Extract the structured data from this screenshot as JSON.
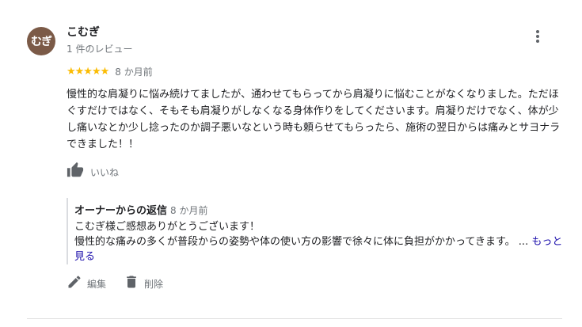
{
  "review": {
    "avatar_text": "むぎ",
    "author": "こむぎ",
    "review_count": "1 件のレビュー",
    "stars": "★★★★★",
    "rating": 5,
    "date": "8 か月前",
    "text": "慢性的な肩凝りに悩み続けてましたが、通わせてもらってから肩凝りに悩むことがなくなりました。ただほぐすだけではなく、そもそも肩凝りがしなくなる身体作りをしてくださいます。肩凝りだけでなく、体が少し痛いなとか少し捻ったのか調子悪いなという時も頼らせてもらったら、施術の翌日からは痛みとサヨナラできました！！",
    "like_label": "いいね",
    "star_color": "#fbbc04"
  },
  "reply": {
    "owner_label": "オーナーからの返信",
    "date": "8 か月前",
    "line1": "こむぎ様ご感想ありがとうございます！",
    "line2": "慢性的な痛みの多くが普段からの姿勢や体の使い方の影響で徐々に体に負担がかかってきます。",
    "ellipsis": " ... ",
    "more_link": "もっと見る"
  },
  "actions": {
    "edit_label": "編集",
    "delete_label": "削除"
  },
  "icons": [
    "more-vert-icon",
    "thumb-up-icon",
    "pencil-icon",
    "trash-icon"
  ]
}
